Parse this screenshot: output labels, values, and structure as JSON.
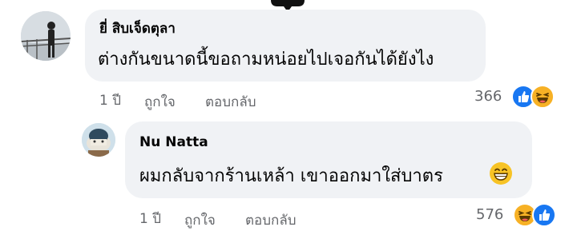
{
  "comments": [
    {
      "author": "ยี่ สิบเจ็ดตุลา",
      "text": "ต่างกันขนาดนี้ขอถามหน่อยไปเจอกันได้ยังไง",
      "time": "1 ปี",
      "like_label": "ถูกใจ",
      "reply_label": "ตอบกลับ",
      "reaction_count": "366",
      "reactions": [
        "like-reaction-icon",
        "haha-reaction-icon"
      ]
    },
    {
      "author": "Nu Natta",
      "text": "ผมกลับจากร้านเหล้า เขาออกมาใส่บาตร",
      "inline_emoji": "grinning-face-icon",
      "time": "1 ปี",
      "like_label": "ถูกใจ",
      "reply_label": "ตอบกลับ",
      "reaction_count": "576",
      "reactions": [
        "haha-reaction-icon",
        "like-reaction-icon"
      ]
    }
  ],
  "colors": {
    "bubble": "#f0f2f5",
    "meta_text": "#65676b",
    "like_blue": "#1877f2",
    "haha_yellow": "#f7b125"
  }
}
